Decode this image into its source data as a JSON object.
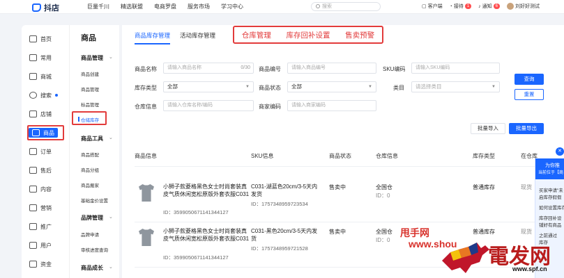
{
  "topbar": {
    "brand": "抖店",
    "nav": [
      "巨量千川",
      "精选联盟",
      "电商罗盘",
      "服务市场",
      "学习中心"
    ],
    "search_placeholder": "搜索",
    "client": "客户端",
    "service": "接待",
    "service_badge": "1",
    "notice": "通知",
    "notice_badge": "6",
    "user": "刘好好测试"
  },
  "leftnav": {
    "items": [
      {
        "label": "首页",
        "icon": "home-icon"
      },
      {
        "label": "常用",
        "icon": "star-icon"
      },
      {
        "label": "商城",
        "icon": "mall-icon"
      },
      {
        "label": "搜索",
        "icon": "search-icon"
      },
      {
        "label": "店铺",
        "icon": "shop-icon"
      },
      {
        "label": "商品",
        "icon": "goods-icon"
      },
      {
        "label": "订单",
        "icon": "order-icon"
      },
      {
        "label": "售后",
        "icon": "aftersale-icon"
      },
      {
        "label": "内容",
        "icon": "content-icon"
      },
      {
        "label": "营销",
        "icon": "marketing-icon"
      },
      {
        "label": "推广",
        "icon": "promote-icon"
      },
      {
        "label": "用户",
        "icon": "user-icon"
      },
      {
        "label": "资金",
        "icon": "fund-icon"
      }
    ],
    "active": "商品"
  },
  "subnav": {
    "title": "商品",
    "groups": [
      {
        "label": "商品管理",
        "items": [
          "商品创建",
          "商品管理",
          "标品管理",
          "仓储库存"
        ]
      },
      {
        "label": "商品工具",
        "items": [
          "商品搭配",
          "商品分组",
          "商品搬家",
          "基础金价设置"
        ]
      },
      {
        "label": "品牌管理",
        "items": [
          "品牌申请",
          "审核进度查询"
        ]
      },
      {
        "label": "商品成长",
        "items": []
      }
    ],
    "active": "仓储库存"
  },
  "tabs": [
    "商品库存管理",
    "活动库存管理"
  ],
  "highlight_tabs": [
    "仓库管理",
    "库存回补设置",
    "售卖预警"
  ],
  "filters": {
    "product_name_label": "商品名称",
    "product_name_placeholder": "请输入商品名称",
    "product_name_count": "0/30",
    "product_code_label": "商品编号",
    "product_code_placeholder": "请输入商品编号",
    "sku_code_label": "SKU编码",
    "sku_code_placeholder": "请输入SKU编码",
    "stock_type_label": "库存类型",
    "stock_type_value": "全部",
    "status_label": "商品状态",
    "status_value": "全部",
    "category_label": "类目",
    "category_placeholder": "请选择类目",
    "warehouse_label": "仓库信息",
    "warehouse_placeholder": "请输入仓库名称/编码",
    "merchant_code_label": "商家编码",
    "merchant_code_placeholder": "请输入商家编码",
    "query": "查询",
    "reset": "重置",
    "batch_import": "批量导入",
    "batch_export": "批量导出"
  },
  "table": {
    "headers": [
      "商品信息",
      "SKU信息",
      "商品状态",
      "仓库信息",
      "库存类型",
      "在仓库"
    ],
    "rows": [
      {
        "name": "小狮子款菱格黑色女士时尚套装真皮气质休闲宽松原版外套衣服C031",
        "id": "ID：3599050671141344127",
        "sku": "C031-湖蓝色20cm/3-5天内发货",
        "sku_id": "ID：1757348959723534",
        "status": "售卖中",
        "warehouse": "全国仓",
        "warehouse_id": "ID：0",
        "stock_type": "普通库存",
        "extra": "现货"
      },
      {
        "name": "小狮子款菱格黑色女士时尚套装真皮气质休闲宽松原版外套衣服C031",
        "id": "ID：3599050671141344127",
        "sku": "C031-黑色20cm/3-5天内发货",
        "sku_id": "ID：1757348959721528",
        "status": "售卖中",
        "warehouse": "全国仓",
        "warehouse_id": "ID：0",
        "stock_type": "普通库存",
        "extra": "现货"
      }
    ]
  },
  "panel": {
    "title_1": "为你推",
    "title_2": "当前位于【商",
    "items": [
      "买家申请\"未",
      "启库存假假",
      "如何设置库存",
      "库存回补设",
      "铺好有商品",
      "之前通过",
      "库存"
    ]
  },
  "watermark": {
    "line1": "甩手网",
    "line2": "www.shou",
    "big": "電发网",
    "url": "www.spf.cn"
  },
  "colors": {
    "accent": "#1a66ff",
    "highlight": "#e23b3b"
  }
}
